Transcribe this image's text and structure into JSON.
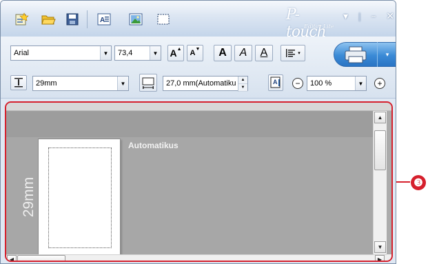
{
  "titlebar": {
    "brand_main": "P-touch",
    "brand_sub": "Editor Lite",
    "icons": [
      "new-icon",
      "open-folder-icon",
      "save-icon",
      "text-insert-icon",
      "image-insert-icon",
      "frame-insert-icon"
    ],
    "menu_arrow": "▾",
    "minimize": "–",
    "close": "✕"
  },
  "toolbar1": {
    "font_value": "Arial",
    "size_value": "73,4",
    "grow_label": "A",
    "shrink_label": "A",
    "bold_label": "A",
    "italic_label": "A",
    "underline_label": "A",
    "print_split_arrow": "▾"
  },
  "toolbar2": {
    "tape_width_value": "29mm",
    "label_length_value": "27,0 mm(Automatiku",
    "zoom_value": "100 %",
    "zoom_out": "−",
    "zoom_in": "+"
  },
  "canvas": {
    "tape_width_label": "29mm",
    "auto_length_label": "Automatikus"
  },
  "callout": {
    "number": "❸",
    "color": "#d6202d"
  }
}
